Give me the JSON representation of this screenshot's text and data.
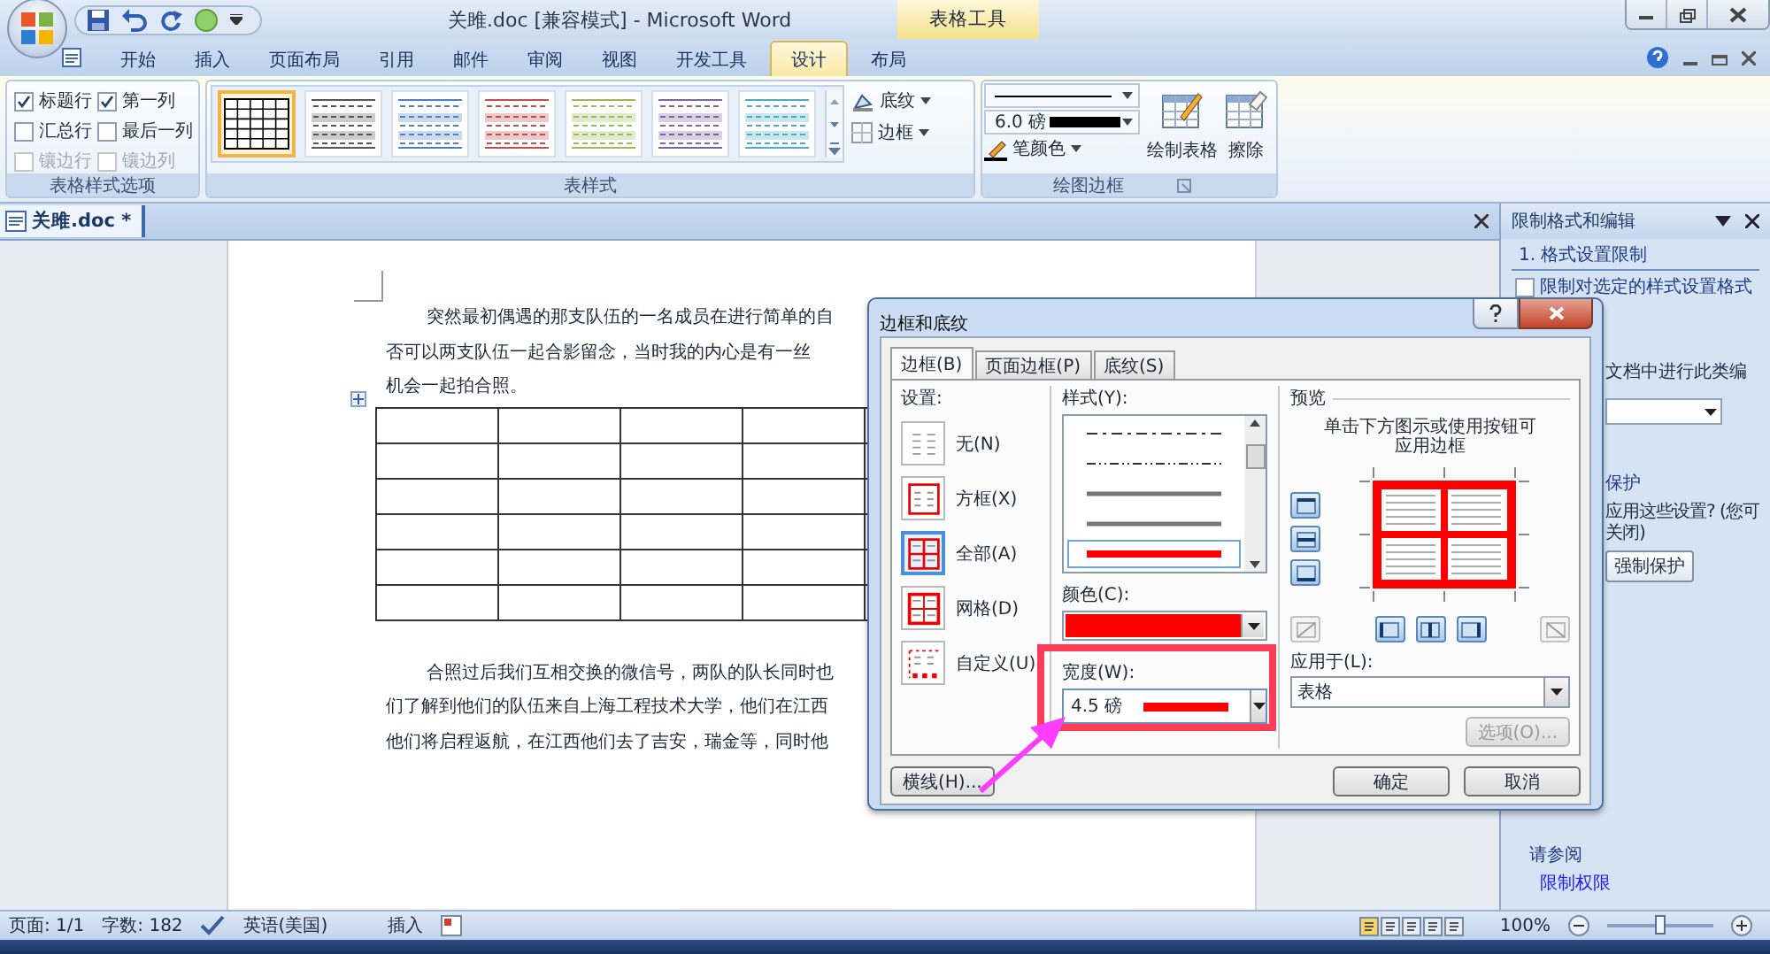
{
  "window": {
    "title": "关雎.doc [兼容模式] - Microsoft Word",
    "contextual_tab": "表格工具"
  },
  "ribbon_tabs": [
    {
      "label": "开始",
      "selected": false
    },
    {
      "label": "插入",
      "selected": false
    },
    {
      "label": "页面布局",
      "selected": false
    },
    {
      "label": "引用",
      "selected": false
    },
    {
      "label": "邮件",
      "selected": false
    },
    {
      "label": "审阅",
      "selected": false
    },
    {
      "label": "视图",
      "selected": false
    },
    {
      "label": "开发工具",
      "selected": false
    },
    {
      "label": "设计",
      "selected": true
    },
    {
      "label": "布局",
      "selected": false
    }
  ],
  "ribbon": {
    "style_options": {
      "group_label": "表格样式选项",
      "options": [
        {
          "label": "标题行",
          "checked": true,
          "disabled": false
        },
        {
          "label": "第一列",
          "checked": true,
          "disabled": false
        },
        {
          "label": "汇总行",
          "checked": false,
          "disabled": false
        },
        {
          "label": "最后一列",
          "checked": false,
          "disabled": false
        },
        {
          "label": "镶边行",
          "checked": false,
          "disabled": true
        },
        {
          "label": "镶边列",
          "checked": false,
          "disabled": true
        }
      ]
    },
    "table_styles": {
      "group_label": "表样式",
      "styles": [
        {
          "kind": "grid",
          "color": "#000000",
          "selected": true
        },
        {
          "kind": "banded",
          "color": "#555555",
          "selected": false
        },
        {
          "kind": "banded",
          "color": "#4f81bd",
          "selected": false
        },
        {
          "kind": "banded",
          "color": "#c0504d",
          "selected": false
        },
        {
          "kind": "banded",
          "color": "#9bbb59",
          "selected": false
        },
        {
          "kind": "banded",
          "color": "#8064a2",
          "selected": false
        },
        {
          "kind": "banded",
          "color": "#4bacc6",
          "selected": false
        }
      ],
      "shading_button": "底纹",
      "borders_button": "边框"
    },
    "draw_borders": {
      "group_label": "绘图边框",
      "pen_weight": "6.0 磅",
      "pen_color_button": "笔颜色",
      "draw_table_button": "绘制表格",
      "eraser_button": "擦除"
    }
  },
  "document_tab": {
    "label": "关雎.doc *"
  },
  "document": {
    "paragraphs": [
      {
        "lines": [
          "突然最初偶遇的那支队伍的一名成员在进行简单的自",
          "否可以两支队伍一起合影留念，当时我的内心是有一丝",
          "机会一起拍合照。"
        ]
      },
      {
        "lines": [
          "合照过后我们互相交换的微信号，两队的队长同时也",
          "们了解到他们的队伍来自上海工程技术大学，他们在江西",
          "他们将启程返航，在江西他们去了吉安，瑞金等，同时他"
        ]
      }
    ]
  },
  "dialog": {
    "title": "边框和底纹",
    "tabs": [
      {
        "label": "边框(B)",
        "selected": true
      },
      {
        "label": "页面边框(P)",
        "selected": false
      },
      {
        "label": "底纹(S)",
        "selected": false
      }
    ],
    "setting_label": "设置:",
    "settings": [
      {
        "label": "无(N)",
        "kind": "none",
        "selected": false
      },
      {
        "label": "方框(X)",
        "kind": "box",
        "selected": false
      },
      {
        "label": "全部(A)",
        "kind": "all",
        "selected": true
      },
      {
        "label": "网格(D)",
        "kind": "grid",
        "selected": false
      },
      {
        "label": "自定义(U)",
        "kind": "custom",
        "selected": false
      }
    ],
    "style_label": "样式(Y):",
    "styles": [
      {
        "kind": "dash-dot",
        "selected": false
      },
      {
        "kind": "dash-dot-dot",
        "selected": false
      },
      {
        "kind": "solid",
        "selected": false
      },
      {
        "kind": "solid",
        "selected": false
      },
      {
        "kind": "thick",
        "selected": true
      }
    ],
    "color_label": "颜色(C):",
    "color": "#ff0000",
    "width_label": "宽度(W):",
    "width_value": "4.5 磅",
    "preview_label": "预览",
    "preview_hint": "单击下方图示或使用按钮可应用边框",
    "apply_label": "应用于(L):",
    "apply_value": "表格",
    "options_button": {
      "label": "选项(O)...",
      "disabled": true
    },
    "horizontal_line_button": "横线(H)...",
    "ok_button": "确定",
    "cancel_button": "取消"
  },
  "task_pane": {
    "title": "限制格式和编辑",
    "section_1": "1. 格式设置限制",
    "restrict_checkbox": {
      "label": "限制对选定的样式设置格式",
      "checked": false
    },
    "section_2_fragment": "文档中进行此类编",
    "section_3_fragment": "保护",
    "apply_question_lines": [
      "应用这些设置? (您可",
      "关闭)"
    ],
    "enforce_button": "强制保护",
    "see_also": "请参阅",
    "permission_link": "限制权限"
  },
  "status_bar": {
    "page": "页面: 1/1",
    "words": "字数: 182",
    "language": "英语(美国)",
    "mode": "插入",
    "zoom": "100%",
    "zoom_slider": {
      "level": 0.5
    }
  }
}
